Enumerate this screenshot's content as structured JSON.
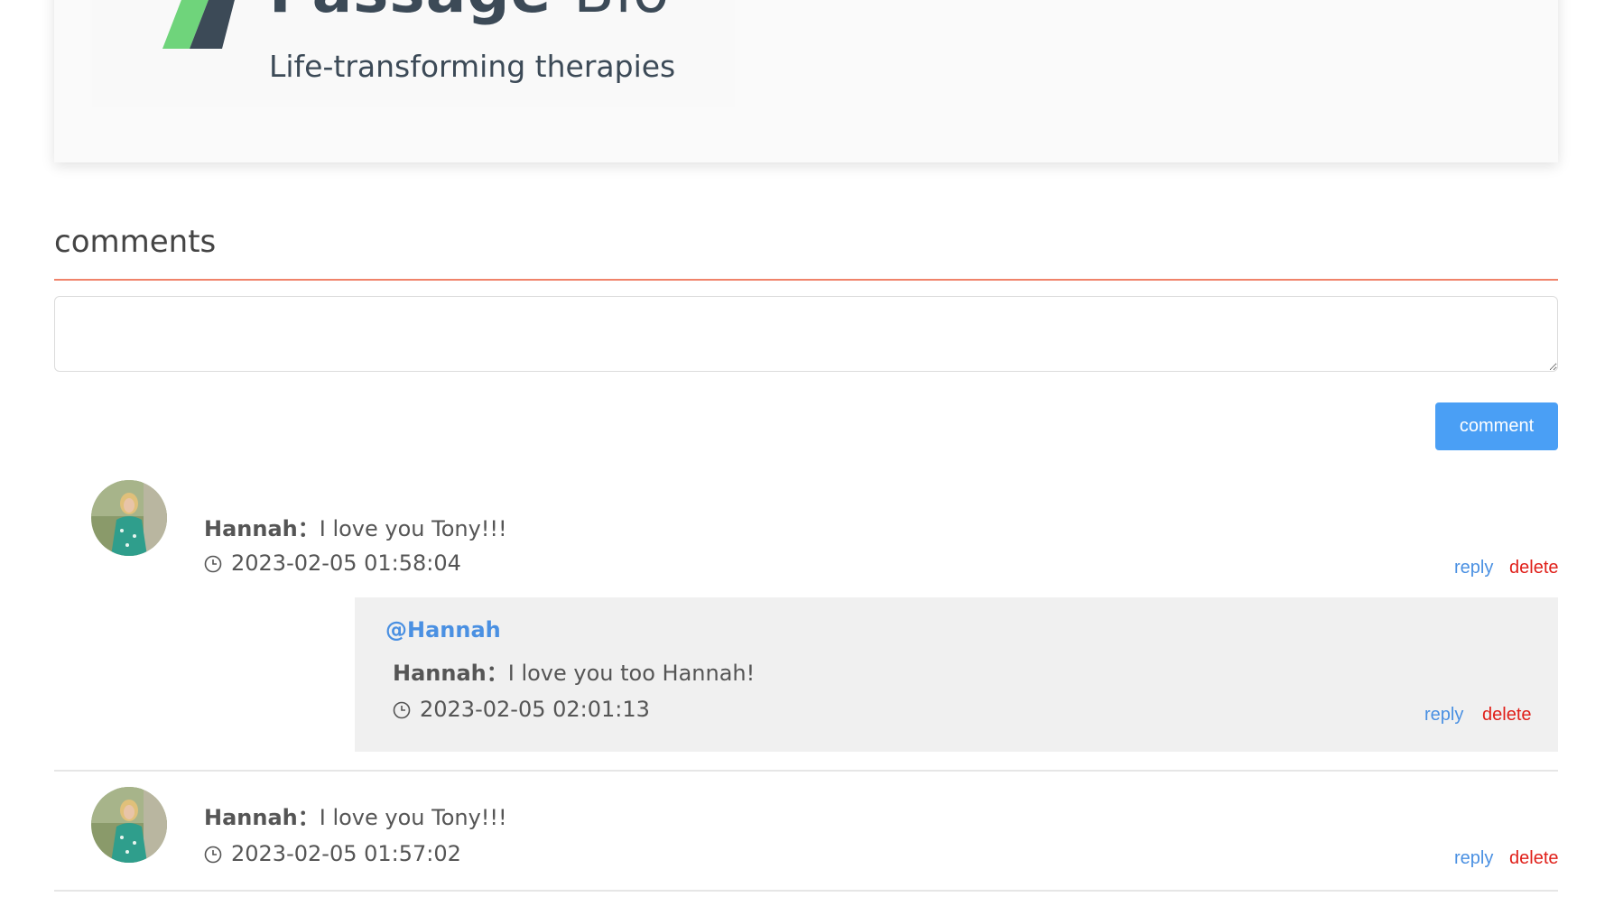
{
  "article": {
    "logo_word": "Passage",
    "logo_word_suffix": "Bio",
    "logo_tagline": "Life-transforming therapies"
  },
  "comments_section": {
    "title": "comments",
    "input_value": "",
    "input_placeholder": "",
    "submit_label": "comment"
  },
  "comments": [
    {
      "author": "Hannah",
      "separator": "：",
      "text": "I love you Tony!!!",
      "timestamp": "2023-02-05 01:58:04",
      "reply_label": "reply",
      "delete_label": "delete",
      "replies": [
        {
          "mention": "@Hannah",
          "author": "Hannah",
          "separator": "：",
          "text": "I love you too Hannah!",
          "timestamp": "2023-02-05 02:01:13",
          "reply_label": "reply",
          "delete_label": "delete"
        }
      ]
    },
    {
      "author": "Hannah",
      "separator": "：",
      "text": "I love you Tony!!!",
      "timestamp": "2023-02-05 01:57:02",
      "reply_label": "reply",
      "delete_label": "delete",
      "replies": []
    }
  ],
  "colors": {
    "accent_rule": "#f0836a",
    "button_bg": "#4a9ff5",
    "reply_link": "#4a90e2",
    "delete_link": "#e0201a",
    "reply_box_bg": "#f0f0f0"
  },
  "icons": {
    "timestamp": "clock-icon",
    "avatar": "avatar-photo",
    "resize": "resize-grip-icon"
  }
}
